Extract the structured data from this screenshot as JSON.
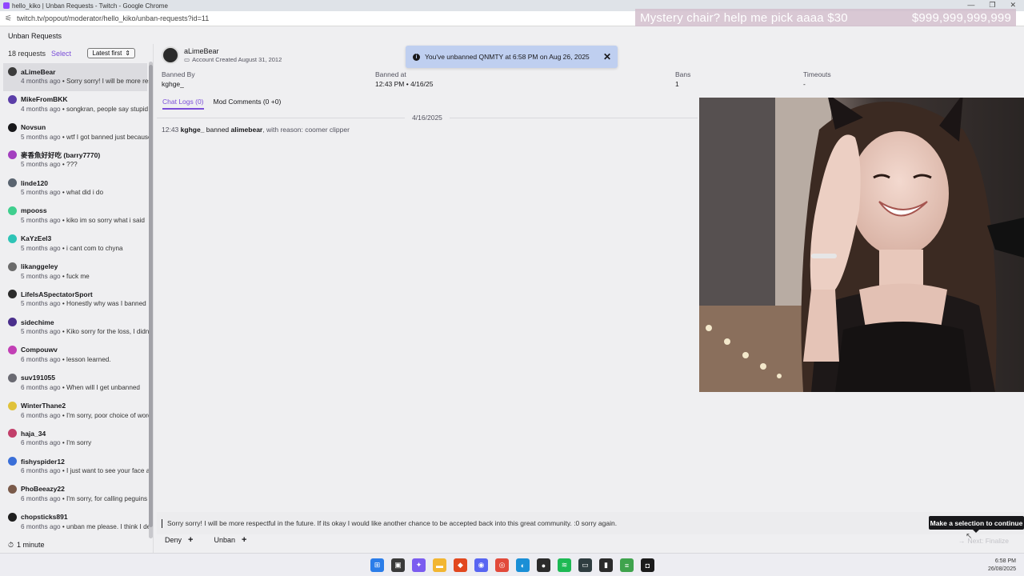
{
  "window": {
    "title": "hello_kiko | Unban Requests - Twitch - Google Chrome",
    "url": "twitch.tv/popout/moderator/hello_kiko/unban-requests?id=11"
  },
  "overlay": {
    "goal_text": "Mystery chair? help me pick aaaa $30",
    "money_text": "$999,999,999,999"
  },
  "page": {
    "title": "Unban Requests"
  },
  "sidebar": {
    "count": "18 requests",
    "select_label": "Select",
    "sort_label": "Latest first",
    "footer_label": "1 minute",
    "requests": [
      {
        "name": "aLimeBear",
        "age": "4 months ago",
        "msg": "Sorry sorry! I will be more respectful in the future.",
        "color": "#3b3b3b"
      },
      {
        "name": "MikeFromBKK",
        "age": "4 months ago",
        "msg": "songkran, people say stupid things",
        "color": "#5b3ea8"
      },
      {
        "name": "Novsun",
        "age": "5 months ago",
        "msg": "wtf I got banned just because",
        "color": "#18181b"
      },
      {
        "name": "麥香魚好好吃 (barry7770)",
        "age": "5 months ago",
        "msg": "???",
        "color": "#a33fbf"
      },
      {
        "name": "linde120",
        "age": "5 months ago",
        "msg": "what did i do",
        "color": "#5a6470"
      },
      {
        "name": "mpooss",
        "age": "5 months ago",
        "msg": "kiko im so sorry what i said",
        "color": "#3fcf8e"
      },
      {
        "name": "KaYzEel3",
        "age": "5 months ago",
        "msg": "i cant com to chyna",
        "color": "#2ec4b6"
      },
      {
        "name": "likanggeley",
        "age": "5 months ago",
        "msg": "fuck me",
        "color": "#6b6b6b"
      },
      {
        "name": "LifeIsASpectatorSport",
        "age": "5 months ago",
        "msg": "Honestly why was I banned",
        "color": "#2b2b2b"
      },
      {
        "name": "sidechime",
        "age": "5 months ago",
        "msg": "Kiko sorry for the loss, I didnt mean",
        "color": "#4a2f8c"
      },
      {
        "name": "Compouwv",
        "age": "6 months ago",
        "msg": "lesson learned.",
        "color": "#c23fb5"
      },
      {
        "name": "suv191055",
        "age": "6 months ago",
        "msg": "When will I get unbanned",
        "color": "#6a6a72"
      },
      {
        "name": "WinterThane2",
        "age": "6 months ago",
        "msg": "I'm sorry, poor choice of words",
        "color": "#e0c23a"
      },
      {
        "name": "haja_34",
        "age": "6 months ago",
        "msg": "I'm sorry",
        "color": "#c23f6a"
      },
      {
        "name": "fishyspider12",
        "age": "6 months ago",
        "msg": "I just want to see your face again",
        "color": "#3a6fd8"
      },
      {
        "name": "PhoBeeazy22",
        "age": "6 months ago",
        "msg": "I'm sorry, for calling peguins",
        "color": "#7a5a4a"
      },
      {
        "name": "chopsticks891",
        "age": "6 months ago",
        "msg": "unban me please. I think I deserve",
        "color": "#1f1f1f"
      }
    ]
  },
  "detail": {
    "username": "aLimeBear",
    "account_created": "Account Created August 31, 2012",
    "banned_by_label": "Banned By",
    "banned_by": "kghge_",
    "banned_at_label": "Banned at",
    "banned_at": "12:43 PM • 4/16/25",
    "bans_label": "Bans",
    "bans": "1",
    "timeouts_label": "Timeouts",
    "timeouts": "-",
    "tab_chat": "Chat Logs (0)",
    "tab_mod": "Mod Comments (0 +0)",
    "log_date": "4/16/2025",
    "log_time": "12:43",
    "log_mod": "kghge_",
    "log_action": "banned",
    "log_target": "alimebear",
    "log_reason_label": ", with reason:",
    "log_reason": "coomer clipper"
  },
  "toast": {
    "text": "You've unbanned QNMTY at 6:58 PM on Aug 26, 2025"
  },
  "request_message": "Sorry sorry! I will be more respectful in the future. If its okay I would like another chance to be accepted back into this great community. :0 sorry again.",
  "actions": {
    "deny": "Deny",
    "unban": "Unban",
    "next": "Next: Finalize",
    "tooltip": "Make a selection to continue"
  },
  "clock": {
    "time": "6:58 PM",
    "date": "26/08/2025"
  },
  "colors": {
    "accent": "#7a4dd8",
    "toast_bg": "#bfcff0"
  }
}
